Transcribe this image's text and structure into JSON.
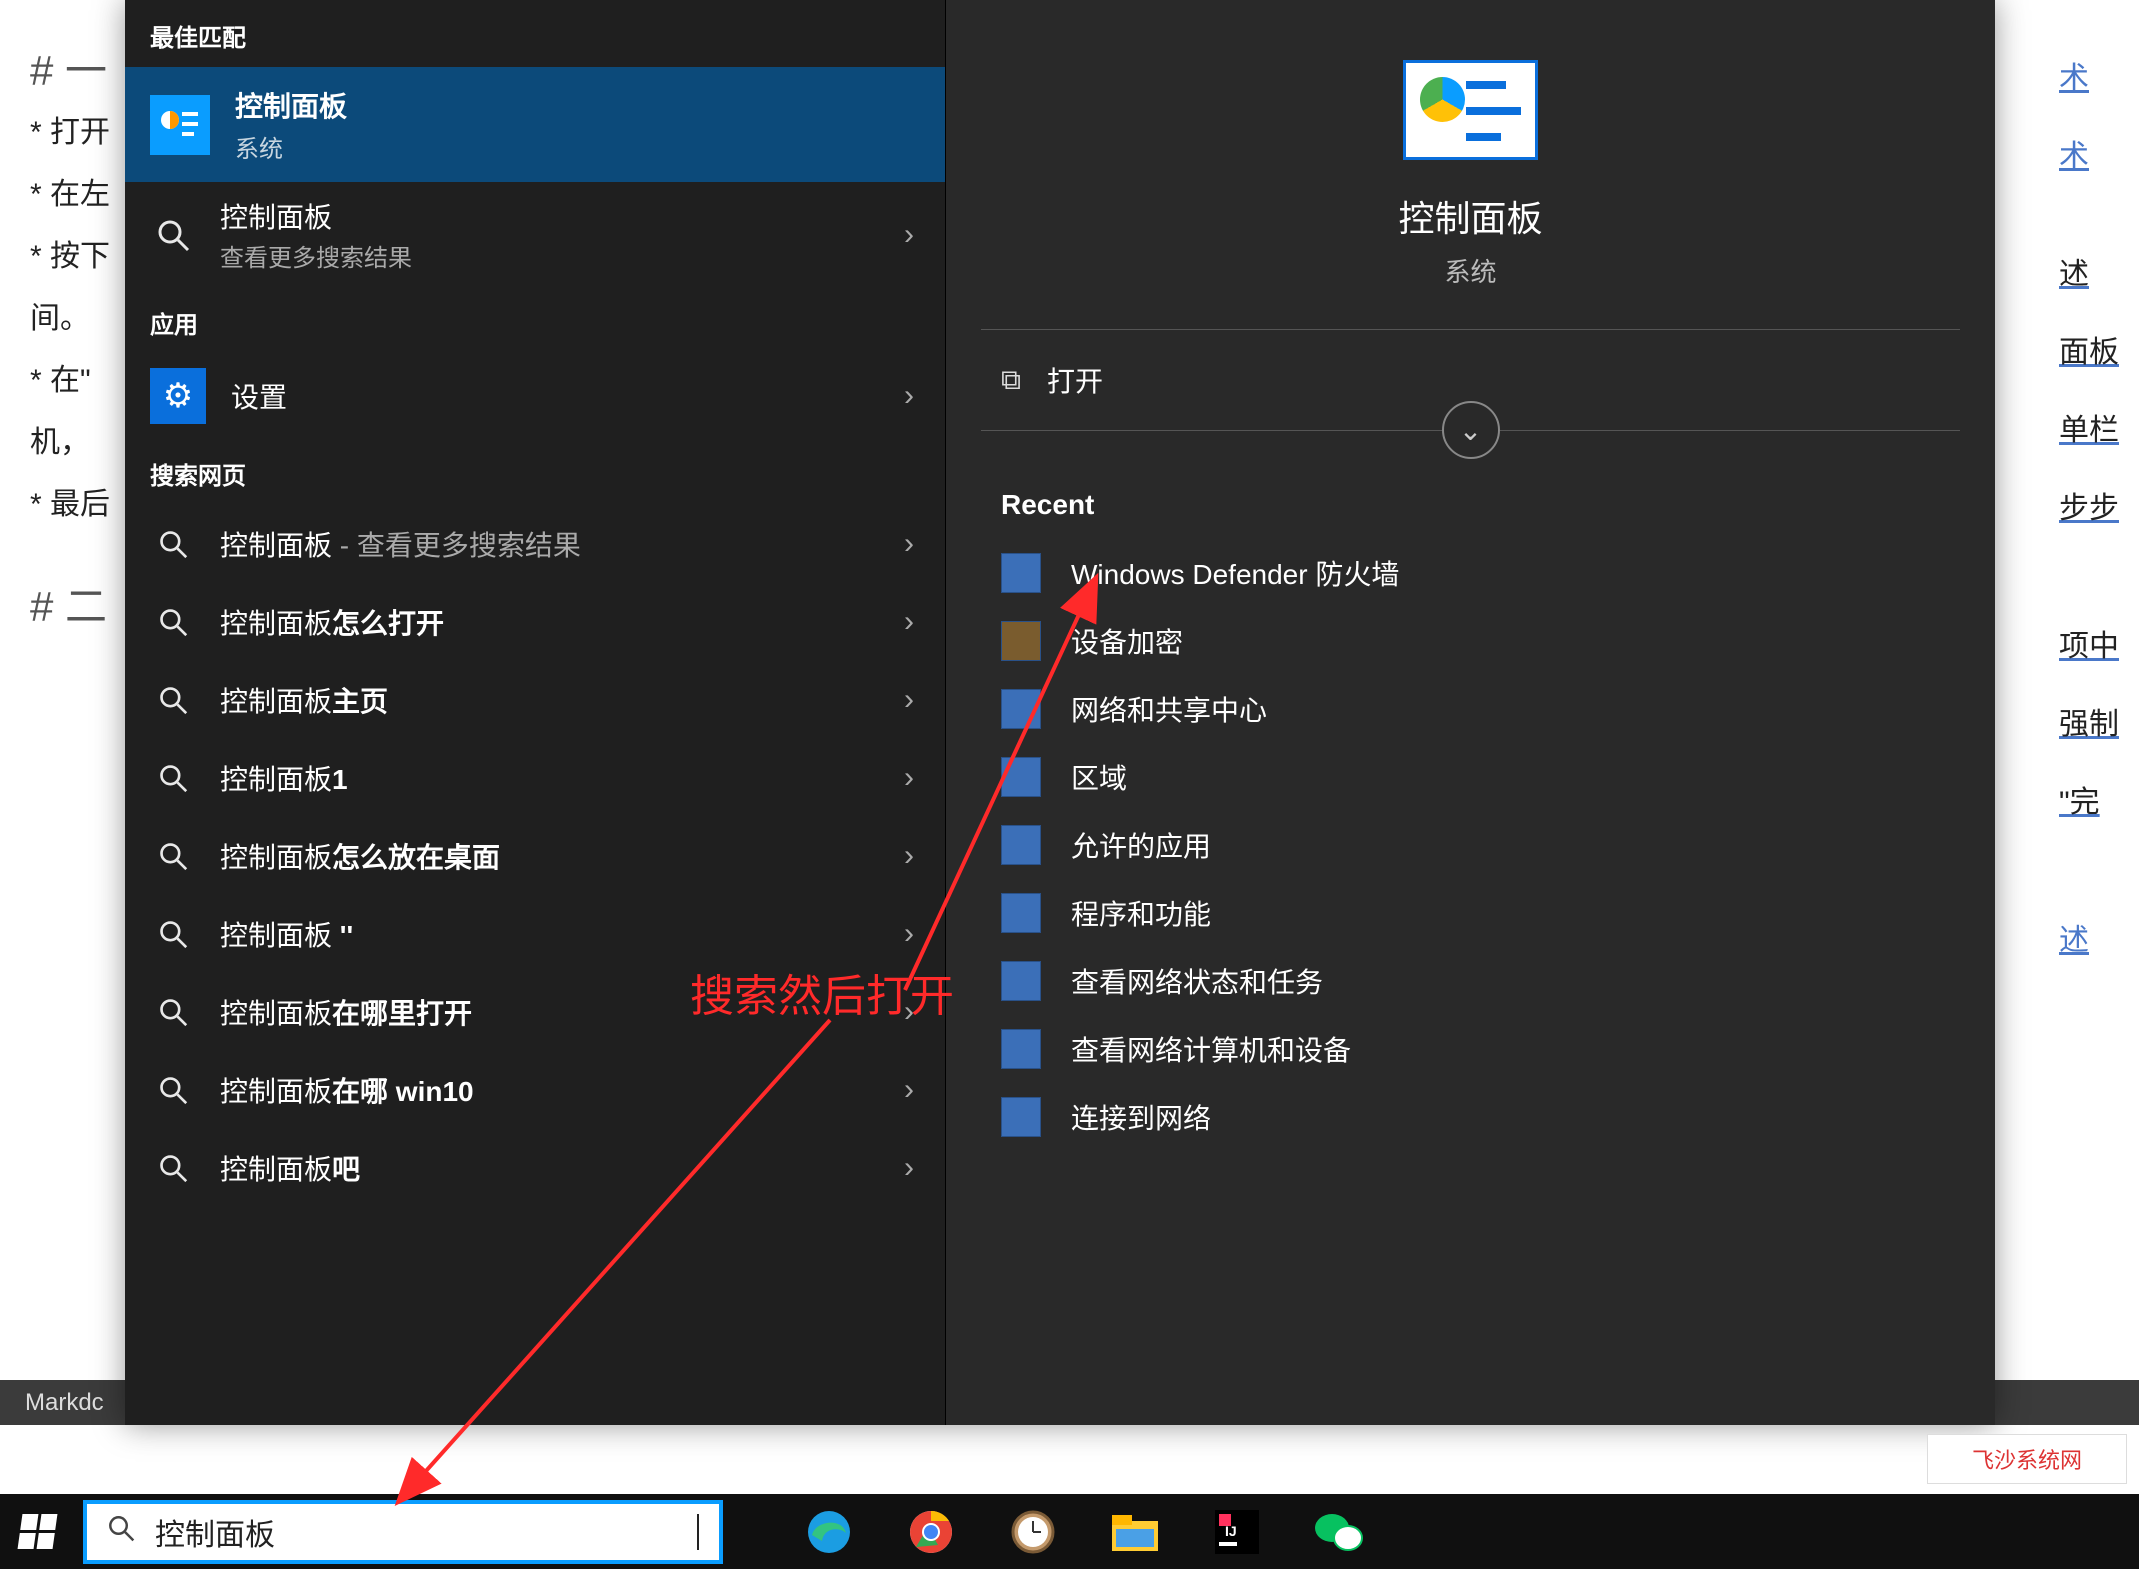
{
  "background": {
    "heading1": "# 一",
    "lines": [
      "* 打开",
      "* 在左",
      "* 按下",
      "间。",
      "* 在\"",
      "机，",
      "* 最后"
    ],
    "heading2": "# 二",
    "statusbar": "Markdc",
    "right_links": [
      "术",
      "术",
      "述",
      "面板",
      "单栏",
      "步步",
      "项中",
      "强制",
      "\"完",
      "述"
    ]
  },
  "search": {
    "best_match_label": "最佳匹配",
    "best": {
      "title": "控制面板",
      "subtitle": "系统"
    },
    "more": {
      "title": "控制面板",
      "subtitle": "查看更多搜索结果"
    },
    "apps_label": "应用",
    "settings": "设置",
    "web_label": "搜索网页",
    "web": [
      {
        "prefix": "控制面板",
        "suffix": " - 查看更多搜索结果",
        "bold_suffix": ""
      },
      {
        "prefix": "控制面板",
        "suffix": "",
        "bold_suffix": "怎么打开"
      },
      {
        "prefix": "控制面板",
        "suffix": "",
        "bold_suffix": "主页"
      },
      {
        "prefix": "控制面板",
        "suffix": "",
        "bold_suffix": "1"
      },
      {
        "prefix": "控制面板",
        "suffix": "",
        "bold_suffix": "怎么放在桌面"
      },
      {
        "prefix": "控制面板",
        "suffix": "",
        "bold_suffix": " ''"
      },
      {
        "prefix": "控制面板",
        "suffix": "",
        "bold_suffix": "在哪里打开"
      },
      {
        "prefix": "控制面板",
        "suffix": "",
        "bold_suffix": "在哪 win10"
      },
      {
        "prefix": "控制面板",
        "suffix": "",
        "bold_suffix": "吧"
      }
    ]
  },
  "detail": {
    "title": "控制面板",
    "subtitle": "系统",
    "open": "打开",
    "recent_label": "Recent",
    "recent": [
      "Windows Defender 防火墙",
      "设备加密",
      "网络和共享中心",
      "区域",
      "允许的应用",
      "程序和功能",
      "查看网络状态和任务",
      "查看网络计算机和设备",
      "连接到网络"
    ]
  },
  "taskbar": {
    "search_value": "控制面板"
  },
  "annotation": {
    "text": "搜索然后打开"
  },
  "watermark": "飞沙系统网"
}
